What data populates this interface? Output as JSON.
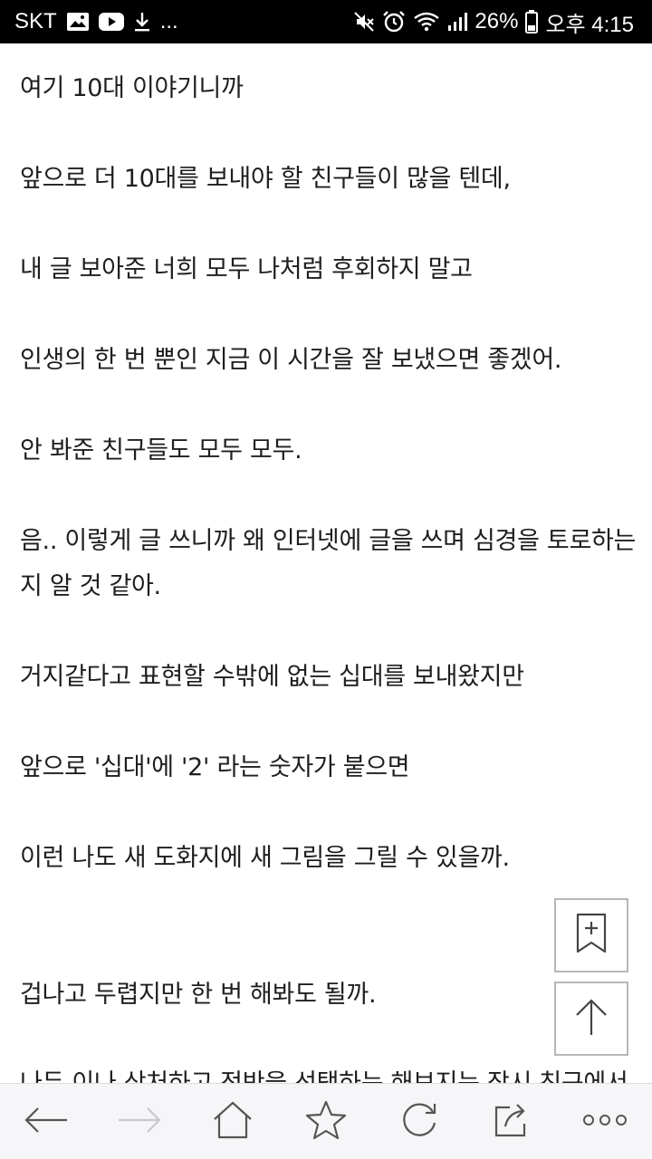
{
  "status_bar": {
    "carrier": "SKT",
    "more": "...",
    "battery": "26%",
    "time": "오후 4:15",
    "icons": [
      "image-icon",
      "youtube-icon",
      "download-icon",
      "mute-icon",
      "alarm-icon",
      "wifi-icon",
      "signal-icon",
      "battery-icon"
    ]
  },
  "article": {
    "paragraphs": [
      "여기 10대 이야기니까",
      "앞으로 더 10대를 보내야 할 친구들이 많을 텐데,",
      "내 글 보아준 너희 모두 나처럼 후회하지 말고",
      "인생의 한 번 뿐인 지금 이 시간을 잘 보냈으면 좋겠어.",
      "안 봐준 친구들도 모두 모두.",
      "음.. 이렇게 글 쓰니까 왜 인터넷에 글을 쓰며 심경을 토로하는지 알 것 같아.",
      "거지같다고 표현할 수밖에 없는 십대를 보내왔지만",
      "앞으로 '십대'에 '2' 라는 숫자가 붙으면",
      "이런 나도 새 도화지에 새 그림을 그릴 수 있을까.",
      "겁나고 두렵지만 한 번 해봐도 될까.",
      "나두 이나 상처하고 전반을 선택하는 해보지는 잠시 친구에서"
    ]
  },
  "floating": {
    "bookmark_add": "bookmark-add-icon",
    "scroll_top": "arrow-up-icon"
  },
  "toolbar": {
    "icons": [
      "back-arrow-icon",
      "forward-arrow-icon",
      "home-icon",
      "star-icon",
      "refresh-icon",
      "share-icon",
      "more-icon"
    ]
  }
}
